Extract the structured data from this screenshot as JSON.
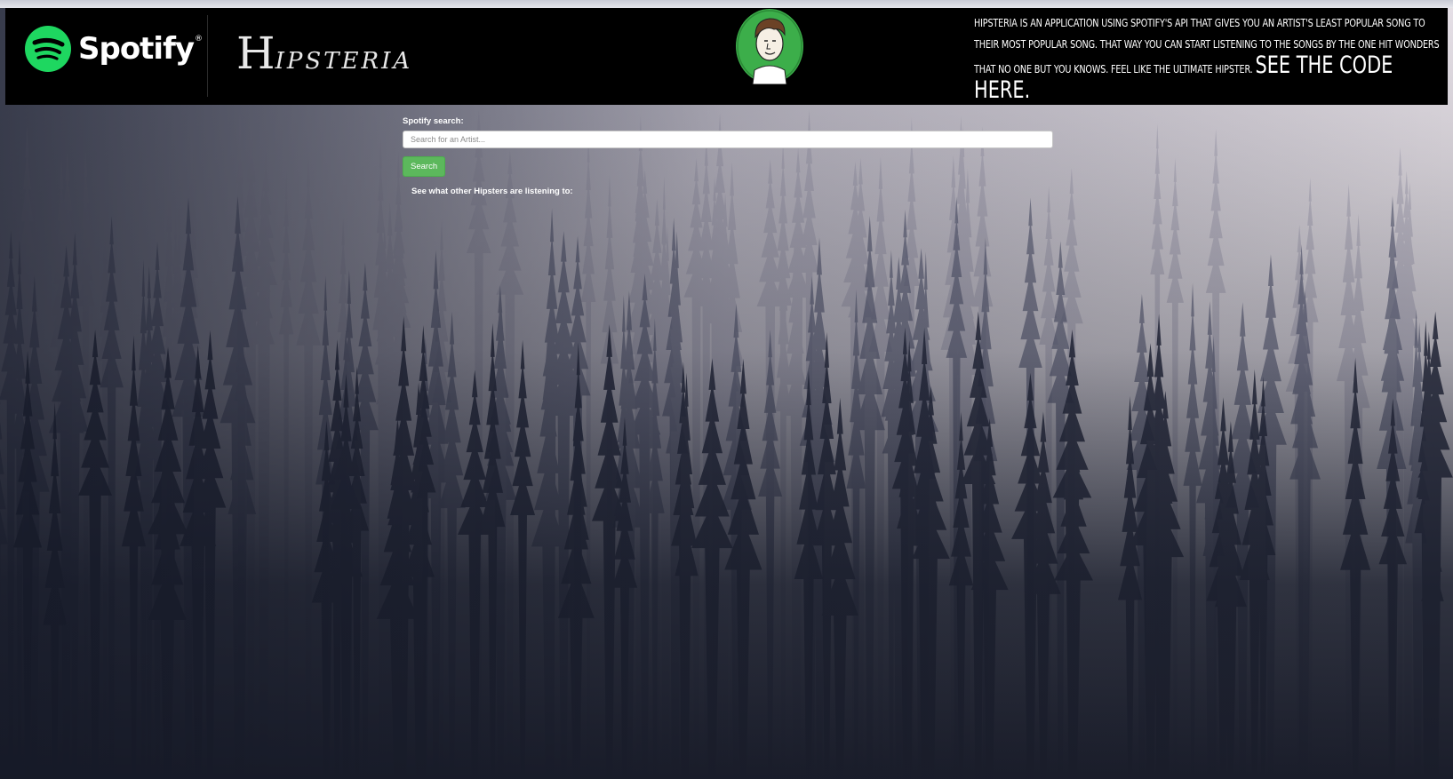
{
  "header": {
    "spotify_wordmark": "Spotify",
    "app_name_initial": "H",
    "app_name_rest": "IPSTERIA",
    "description_text": "Hipsteria is an application using Spotify's API that gives you an artist's least popular song to their most popular song. That way you can start listening to the songs by the one hit wonders that no one but you knows. Feel like the ultimate Hipster.",
    "code_link_label": "See the code here."
  },
  "search": {
    "label": "Spotify search:",
    "placeholder": "Search for an Artist...",
    "value": "",
    "button_label": "Search"
  },
  "other_listeners_label": "See what other Hipsters are listening to:",
  "colors": {
    "spotify_green": "#1ed760",
    "button_green": "#5cb85c",
    "header_bg": "#000000"
  },
  "icons": {
    "spotify_logo": "spotify-logo-icon",
    "avatar": "hipster-avatar-icon"
  }
}
